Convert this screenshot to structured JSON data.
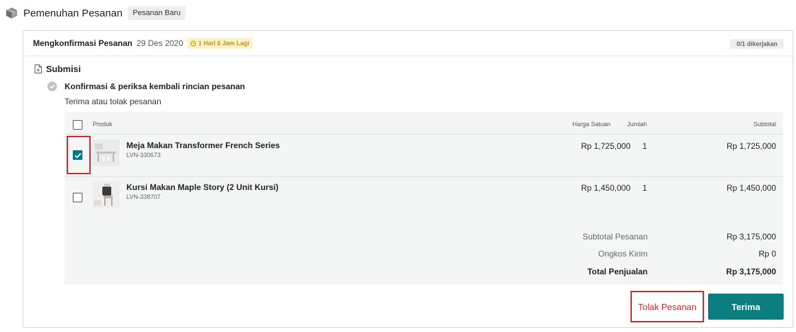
{
  "header": {
    "title": "Pemenuhan Pesanan",
    "badge": "Pesanan Baru",
    "icon": "package-box-icon"
  },
  "card": {
    "title": "Mengkonfirmasi Pesanan",
    "date": "29 Des 2020",
    "timer": "1 Hari 6 Jam Lagi",
    "progress": "0/1 dikerjakan",
    "section": "Submisi",
    "step_title": "Konfirmasi & periksa kembali rincian pesanan",
    "step_subtitle": "Terima atau tolak pesanan"
  },
  "table": {
    "headers": {
      "product": "Produk",
      "unit_price": "Harga Satuan",
      "qty": "Jumlah",
      "subtotal": "Subtotal"
    },
    "rows": [
      {
        "name": "Meja Makan Transformer French Series",
        "sku": "LVN-330673",
        "unit_price": "Rp 1,725,000",
        "qty": "1",
        "subtotal": "Rp 1,725,000",
        "checked": true
      },
      {
        "name": "Kursi Makan Maple Story (2 Unit Kursi)",
        "sku": "LVN-338707",
        "unit_price": "Rp 1,450,000",
        "qty": "1",
        "subtotal": "Rp 1,450,000",
        "checked": false
      }
    ],
    "summary": {
      "subtotal_label": "Subtotal Pesanan",
      "subtotal_value": "Rp 3,175,000",
      "shipping_label": "Ongkos Kirim",
      "shipping_value": "Rp 0",
      "total_label": "Total Penjualan",
      "total_value": "Rp 3,175,000"
    }
  },
  "actions": {
    "reject": "Tolak Pesanan",
    "accept": "Terima"
  },
  "colors": {
    "accent": "#0b7f80",
    "highlight": "#d9232d",
    "timer_bg": "#fdf2c9",
    "timer_text": "#c99500"
  }
}
